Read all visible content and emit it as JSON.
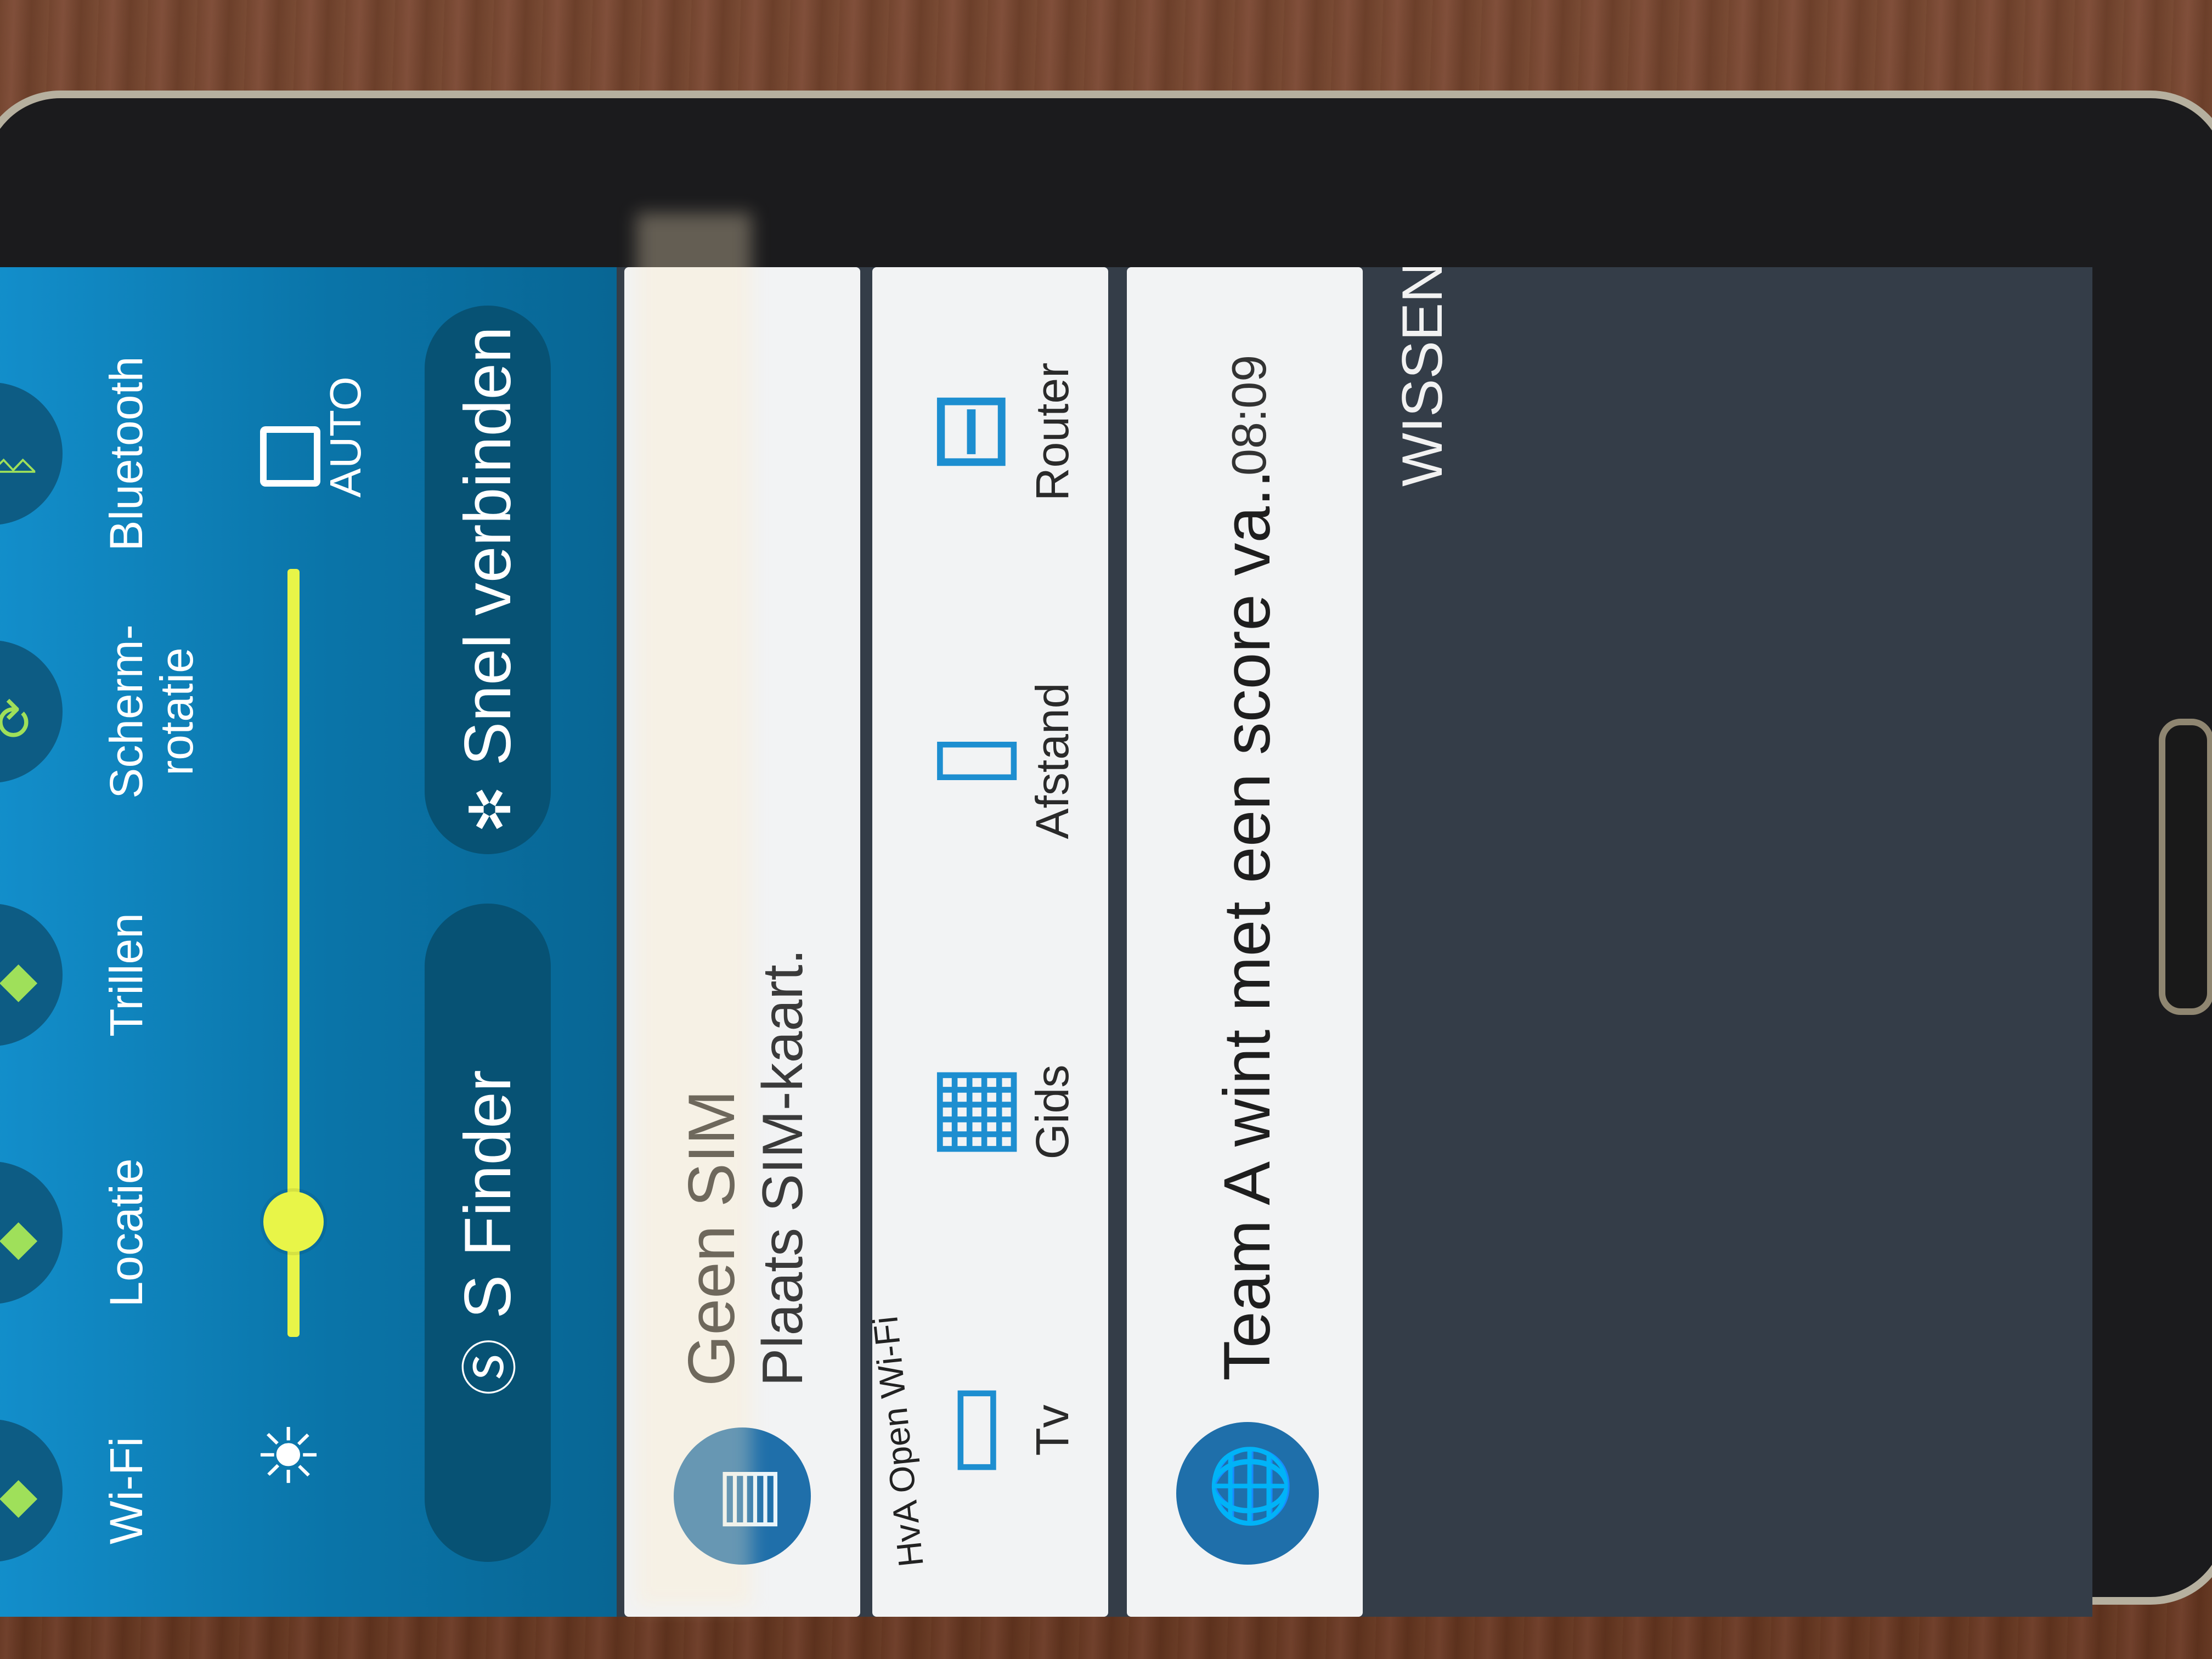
{
  "quick_settings": {
    "toggles": [
      {
        "label": "Wi-Fi",
        "icon": "wifi-icon",
        "glyph": "◆"
      },
      {
        "label": "Locatie",
        "icon": "location-icon",
        "glyph": "◆"
      },
      {
        "label": "Trillen",
        "icon": "vibrate-icon",
        "glyph": "◆"
      },
      {
        "label": "Scherm-\nrotatie",
        "icon": "rotate-icon",
        "glyph": "⟳"
      },
      {
        "label": "Bluetooth",
        "icon": "bluetooth-icon",
        "glyph": "ᛒ"
      }
    ],
    "brightness": {
      "level": 0.15,
      "auto_label": "AUTO"
    },
    "s_finder": {
      "label": "S Finder",
      "glyph": "Ⓢ"
    },
    "quick_connect": {
      "label": "Snel verbinden",
      "glyph": "✲"
    }
  },
  "notifications": {
    "sim": {
      "title": "Geen SIM",
      "subtitle": "Plaats SIM-kaart."
    },
    "remote": {
      "wifi_text": "HvA Open Wi-Fi",
      "items": [
        {
          "label": "Tv",
          "icon": "tv-icon",
          "glyph": "▭"
        },
        {
          "label": "Gids",
          "icon": "guide-icon",
          "glyph": "▦"
        },
        {
          "label": "Afstand",
          "icon": "remote-control-icon",
          "glyph": "▯"
        },
        {
          "label": "Router",
          "icon": "router-icon",
          "glyph": "⊟"
        }
      ]
    },
    "score": {
      "title": "Team A wint met een score va..",
      "time": "08:09",
      "glyph": "🌐"
    },
    "clear_label": "WISSEN"
  },
  "colors": {
    "quick_panel": "#0f86c2",
    "brightness_slider": "#e8f548",
    "notification_background": "#343d48",
    "card_background": "#f2f3f4",
    "accent_blue": "#1d8ed0"
  }
}
